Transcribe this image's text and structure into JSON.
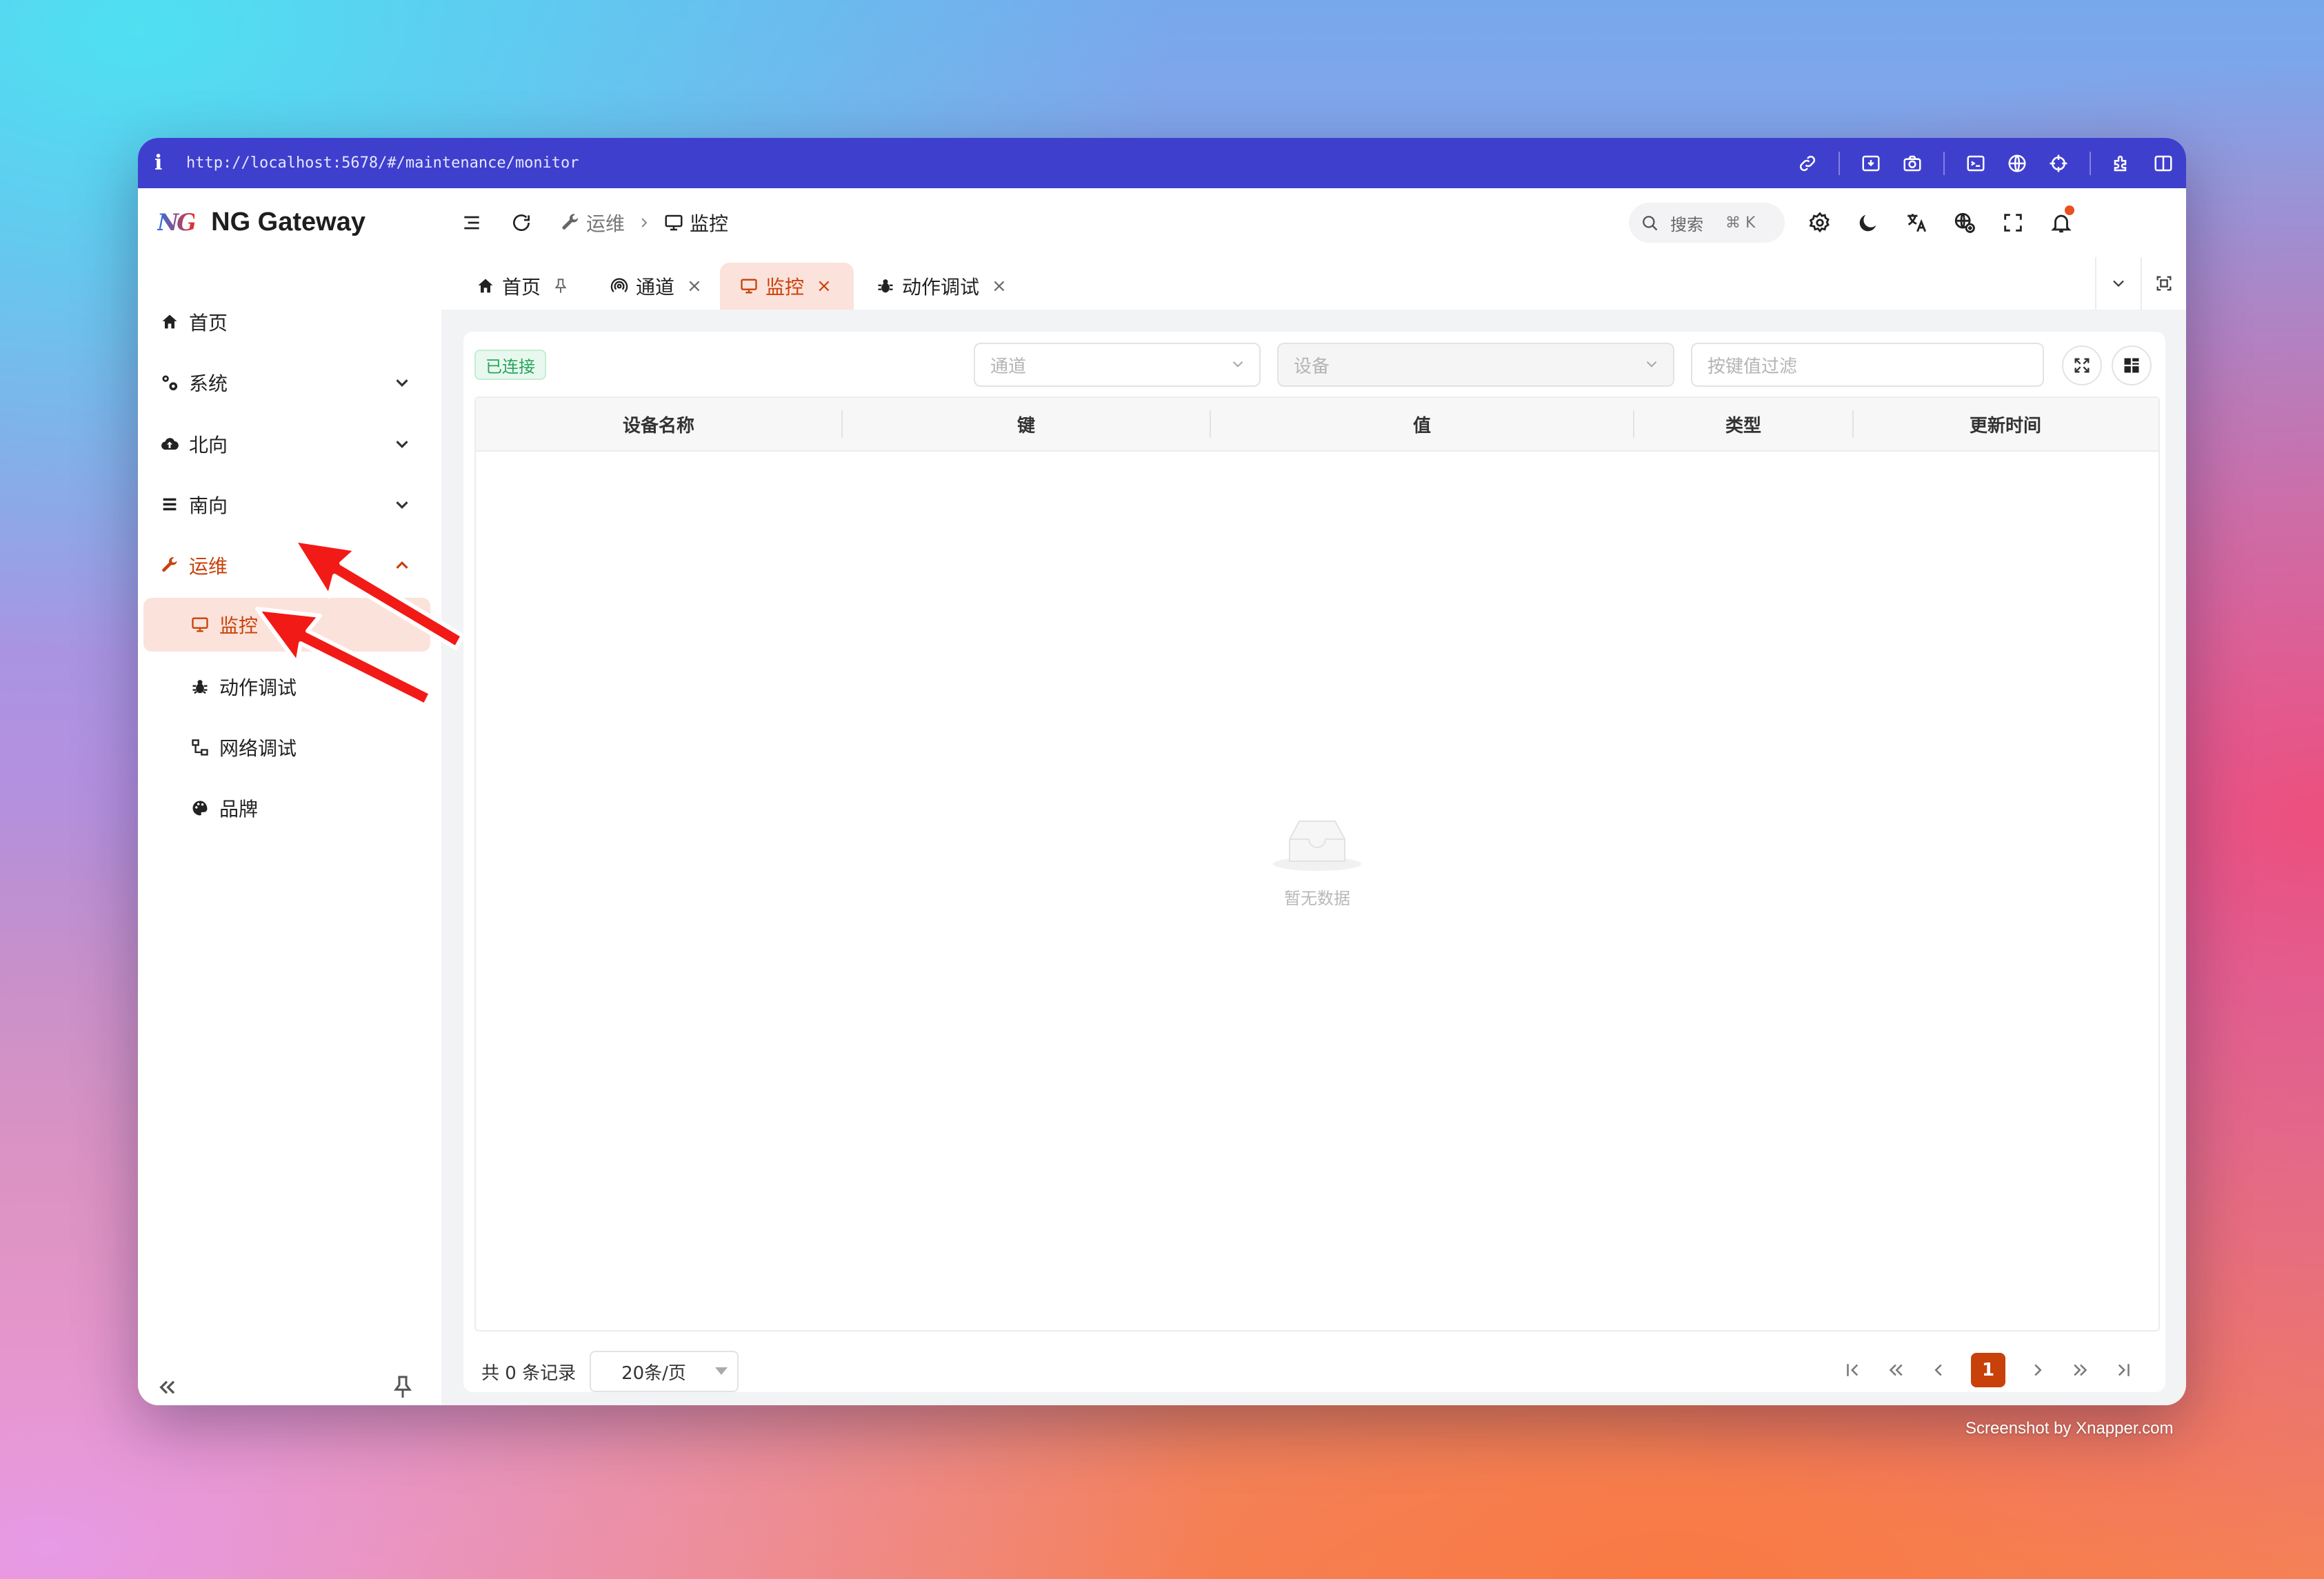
{
  "browser": {
    "info_glyph": "i",
    "url": "http://localhost:5678/#/maintenance/monitor"
  },
  "app": {
    "brand_mark": "NG",
    "name": "NG Gateway"
  },
  "sidebar": {
    "items": [
      {
        "label": "首页",
        "icon": "home-icon"
      },
      {
        "label": "系统",
        "icon": "cogs-icon"
      },
      {
        "label": "北向",
        "icon": "cloud-upload-icon"
      },
      {
        "label": "南向",
        "icon": "list-icon"
      },
      {
        "label": "运维",
        "icon": "wrench-icon",
        "expanded": true
      },
      {
        "label": "监控",
        "icon": "monitor-icon",
        "selected": true
      },
      {
        "label": "动作调试",
        "icon": "bug-icon"
      },
      {
        "label": "网络调试",
        "icon": "network-icon"
      },
      {
        "label": "品牌",
        "icon": "palette-icon"
      }
    ]
  },
  "header": {
    "breadcrumb": [
      "运维",
      "监控"
    ],
    "search": {
      "label": "搜索",
      "shortcut": "⌘ K"
    }
  },
  "tabs": [
    {
      "label": "首页",
      "pinned": true
    },
    {
      "label": "通道",
      "close": "×"
    },
    {
      "label": "监控",
      "close": "×",
      "active": true
    },
    {
      "label": "动作调试",
      "close": "×"
    }
  ],
  "toolbar": {
    "status": "已连接",
    "channel_placeholder": "通道",
    "device_placeholder": "设备",
    "filter_placeholder": "按键值过滤"
  },
  "table": {
    "columns": [
      "设备名称",
      "键",
      "值",
      "类型",
      "更新时间"
    ],
    "rows": [],
    "empty_text": "暂无数据"
  },
  "pagination": {
    "total_text": "共 0 条记录",
    "page_size": "20条/页",
    "current_page": "1"
  },
  "credit": "Screenshot by Xnapper.com",
  "colors": {
    "accent": "#c8410b",
    "url_bar": "#3f3fce",
    "success": "#26a65b",
    "selected_bg": "#fbe2db"
  }
}
